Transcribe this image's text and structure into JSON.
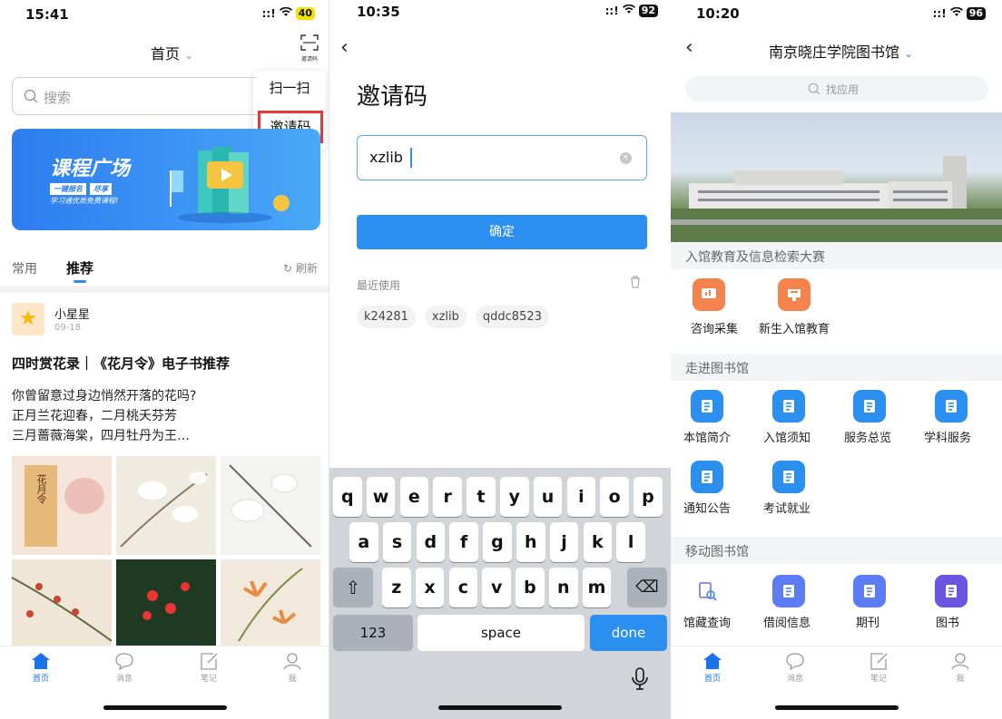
{
  "panel1": {
    "time": "15:41",
    "signal": "::!",
    "battery": "40",
    "header_title": "首页",
    "scan_small_label": "邀请码",
    "menu_scan": "扫一扫",
    "menu_invite": "邀请码",
    "search_placeholder": "搜索",
    "banner_title": "课程广场",
    "banner_sub1": "一键报名",
    "banner_sub2": "尽享",
    "banner_sub3": "学习通优质免费课程!",
    "tab_common": "常用",
    "tab_recommend": "推荐",
    "refresh": "刷新",
    "author": "小星星",
    "date": "09-18",
    "post_title": "四时赏花录｜《花月令》电子书推荐",
    "lines": [
      "你曾留意过身边悄然开落的花吗?",
      "正月兰花迎春，二月桃夭芬芳",
      "三月蔷薇海棠，四月牡丹为王…"
    ],
    "book_cover_text": "花月令",
    "bottom_tabs": [
      "首页",
      "消息",
      "笔记",
      "我"
    ]
  },
  "panel2": {
    "time": "10:35",
    "signal": "::!",
    "battery": "92",
    "title": "邀请码",
    "input_value": "xzlib",
    "confirm": "确定",
    "recent_label": "最近使用",
    "recent_chips": [
      "k24281",
      "xzlib",
      "qddc8523"
    ],
    "keys_row1": [
      "q",
      "w",
      "e",
      "r",
      "t",
      "y",
      "u",
      "i",
      "o",
      "p"
    ],
    "keys_row2": [
      "a",
      "s",
      "d",
      "f",
      "g",
      "h",
      "j",
      "k",
      "l"
    ],
    "keys_row3": [
      "z",
      "x",
      "c",
      "v",
      "b",
      "n",
      "m"
    ],
    "key_123": "123",
    "key_space": "space",
    "key_done": "done"
  },
  "panel3": {
    "time": "10:20",
    "signal": "::!",
    "battery": "96",
    "title": "南京晓庄学院图书馆",
    "search_placeholder": "找应用",
    "section1": "入馆教育及信息检索大赛",
    "section1_items": [
      "咨询采集",
      "新生入馆教育"
    ],
    "section2": "走进图书馆",
    "section2_items": [
      "本馆简介",
      "入馆须知",
      "服务总览",
      "学科服务",
      "通知公告",
      "考试就业"
    ],
    "section3": "移动图书馆",
    "section3_items": [
      "馆藏查询",
      "借阅信息",
      "期刊",
      "图书"
    ],
    "bottom_tabs": [
      "首页",
      "消息",
      "笔记",
      "我"
    ]
  },
  "colors": {
    "accent": "#2b8ff0",
    "orange": "#f5844c",
    "highlight": "#e53935",
    "tab_active": "#1a73e8"
  }
}
